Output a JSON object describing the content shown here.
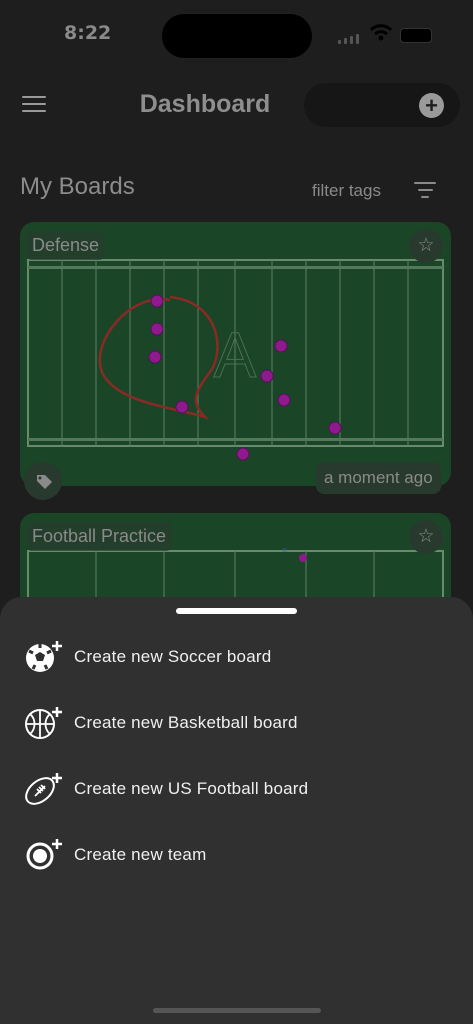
{
  "status": {
    "time": "8:22"
  },
  "header": {
    "title": "Dashboard"
  },
  "section": {
    "title": "My Boards",
    "filter_label": "filter tags"
  },
  "boards": [
    {
      "title": "Defense",
      "updated": "a moment ago"
    },
    {
      "title": "Football Practice"
    }
  ],
  "sheet": {
    "items": [
      {
        "label": "Create new Soccer board",
        "icon": "soccer-ball-plus-icon"
      },
      {
        "label": "Create new Basketball board",
        "icon": "basketball-plus-icon"
      },
      {
        "label": "Create new US Football board",
        "icon": "football-plus-icon"
      },
      {
        "label": "Create new team",
        "icon": "team-plus-icon"
      }
    ]
  },
  "colors": {
    "field": "#1a4527",
    "player": "#8e1a8e",
    "drawing": "#8a2a25",
    "sheet": "#303030"
  }
}
